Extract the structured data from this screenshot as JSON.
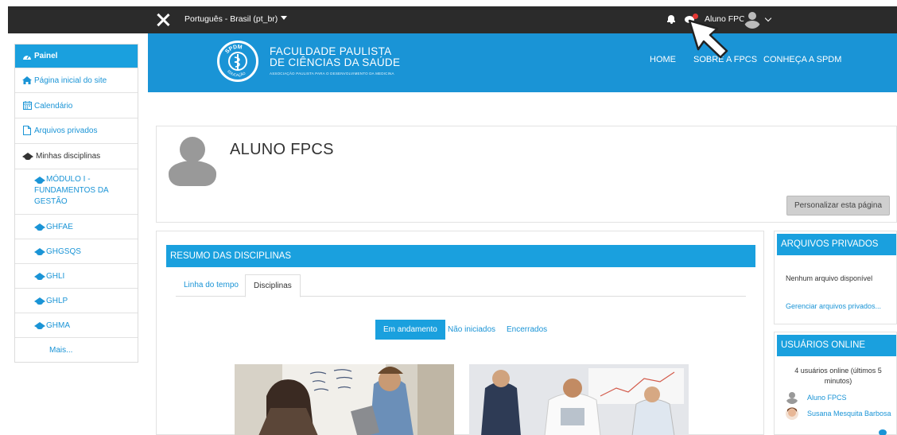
{
  "topbar": {
    "language": "Português - Brasil (pt_br)",
    "username": "Aluno FPCS"
  },
  "header": {
    "title_line1": "FACULDADE PAULISTA",
    "title_line2": "DE CIÊNCIAS DA SAÚDE",
    "subtitle": "ASSOCIAÇÃO PAULISTA PARA O DESENVOLVIMENTO DA MEDICINA",
    "logo_top": "SPDM",
    "logo_bottom": "EDUCAÇÃO",
    "nav": [
      "HOME",
      "SOBRE A FPCS",
      "CONHEÇA A SPDM"
    ]
  },
  "sidebar": {
    "items": [
      {
        "label": "Painel"
      },
      {
        "label": "Página inicial do site"
      },
      {
        "label": "Calendário"
      },
      {
        "label": "Arquivos privados"
      },
      {
        "label": "Minhas disciplinas"
      },
      {
        "label": "MÓDULO I -"
      },
      {
        "label": "GHFAE"
      },
      {
        "label": "GHGSQS"
      },
      {
        "label": "GHLI"
      },
      {
        "label": "GHLP"
      },
      {
        "label": "GHMA"
      },
      {
        "label": "Mais..."
      }
    ],
    "modulo_line2": "FUNDAMENTOS DA",
    "modulo_line3": "GESTÃO"
  },
  "profile": {
    "name": "ALUNO FPCS",
    "customize_button": "Personalizar esta página"
  },
  "courses": {
    "title": "RESUMO DAS DISCIPLINAS",
    "tabs": [
      "Linha do tempo",
      "Disciplinas"
    ],
    "filters": [
      "Em andamento",
      "Não iniciados",
      "Encerrados"
    ]
  },
  "private_files": {
    "title": "ARQUIVOS PRIVADOS",
    "empty_text": "Nenhum arquivo disponível",
    "manage_link": "Gerenciar arquivos privados..."
  },
  "online_users": {
    "title": "USUÁRIOS ONLINE",
    "info_line1": "4 usuários online (últimos 5",
    "info_line2": "minutos)",
    "users": [
      "Aluno FPCS",
      "Susana Mesquita Barbosa"
    ]
  },
  "colors": {
    "accent": "#1aa0de",
    "header_blue": "#1a94d6",
    "navbar": "#2b2b2b",
    "badge": "#e53935"
  }
}
